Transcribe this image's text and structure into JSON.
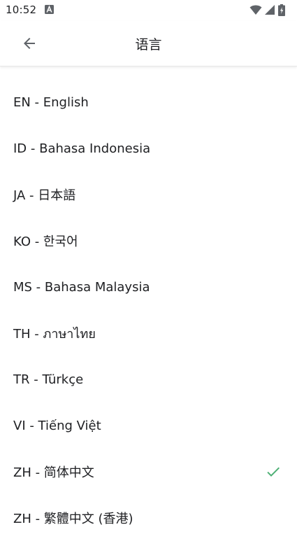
{
  "status_bar": {
    "time": "10:52",
    "app_icon": "font-a-icon",
    "icons": [
      "wifi-icon",
      "cell-signal-icon",
      "battery-charging-icon"
    ]
  },
  "header": {
    "title": "语言",
    "back_icon": "arrow-left-icon"
  },
  "languages": [
    {
      "label": "EN - English",
      "selected": false
    },
    {
      "label": "ID - Bahasa Indonesia",
      "selected": false
    },
    {
      "label": "JA - 日本語",
      "selected": false
    },
    {
      "label": "KO - 한국어",
      "selected": false
    },
    {
      "label": "MS - Bahasa Malaysia",
      "selected": false
    },
    {
      "label": "TH - ภาษาไทย",
      "selected": false
    },
    {
      "label": "TR - Türkçe",
      "selected": false
    },
    {
      "label": "VI - Tiếng Việt",
      "selected": false
    },
    {
      "label": "ZH - 简体中文",
      "selected": true
    },
    {
      "label": "ZH - 繁體中文 (香港)",
      "selected": false
    }
  ],
  "colors": {
    "accent_check": "#4caf74",
    "text": "#202124",
    "icon": "#5f6368"
  }
}
